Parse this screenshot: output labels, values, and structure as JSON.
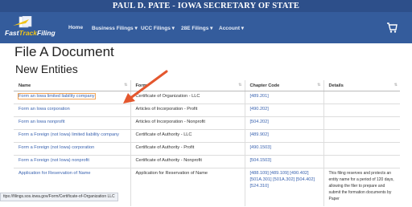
{
  "banner": {
    "title": "PAUL D. PATE - IOWA SECRETARY OF STATE"
  },
  "logo": {
    "text_1": "Fast",
    "text_2": "Track",
    "text_3": "Filing"
  },
  "nav": [
    {
      "label": "Home"
    },
    {
      "label": "Business Filings ▾"
    },
    {
      "label": "UCC Filings ▾"
    },
    {
      "label": "28E Filings ▾"
    },
    {
      "label": "Account ▾"
    }
  ],
  "cart": {
    "icon": "cart-icon"
  },
  "page": {
    "title": "File A Document",
    "subtitle": "New Entities"
  },
  "table": {
    "headers": [
      "Name",
      "Form",
      "Chapter Code",
      "Details"
    ],
    "rows": [
      {
        "name": "Form an Iowa limited liability company",
        "form": "Certificate of Organization - LLC",
        "codes": "[489.201]",
        "details": ""
      },
      {
        "name": "Form an Iowa corporation",
        "form": "Articles of Incorporation - Profit",
        "codes": "[490.202]",
        "details": ""
      },
      {
        "name": "Form an Iowa nonprofit",
        "form": "Articles of Incorporation - Nonprofit",
        "codes": "[504.202]",
        "details": ""
      },
      {
        "name": "Form a Foreign (not Iowa) limited liability company",
        "form": "Certificate of Authority - LLC",
        "codes": "[489.902]",
        "details": ""
      },
      {
        "name": "Form a Foreign (not Iowa) corporation",
        "form": "Certificate of Authority - Profit",
        "codes": "[490.1503]",
        "details": ""
      },
      {
        "name": "Form a Foreign (not Iowa) nonprofit",
        "form": "Certificate of Authority - Nonprofit",
        "codes": "[504.1503]",
        "details": ""
      },
      {
        "name": "Application for Reservation of Name",
        "form": "Application for Reservation of Name",
        "codes": "[488.109] [489.109] [490.402] [501A.301] [501A.302] [504.402] [524.310]",
        "details": "This filing reserves and protects an entity name for a period of 120 days, allowing the filer to prepare and submit the formation documents by Paper"
      }
    ]
  },
  "status_bar": {
    "url": "ttps://filings.sos.iowa.gov/Form/Certificate-of-Organization LLC"
  },
  "colors": {
    "banner": "#2d4f8a",
    "navbar": "#345c9c",
    "link": "#3a63b0",
    "highlight": "#e08a3c",
    "arrow": "#e4572e"
  }
}
